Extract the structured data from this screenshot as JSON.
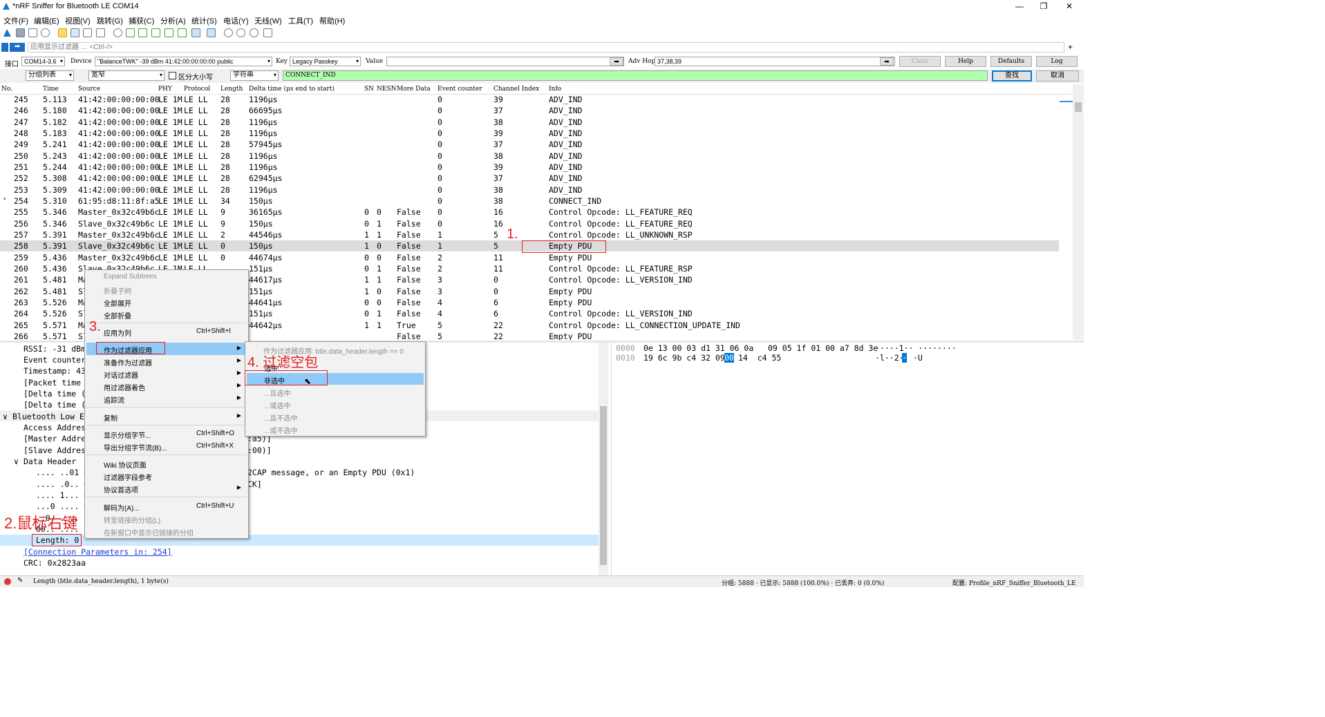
{
  "window": {
    "title": "*nRF Sniffer for Bluetooth LE COM14",
    "minimize": "—",
    "restore": "❐",
    "close": "✕"
  },
  "menu": [
    "文件(F)",
    "编辑(E)",
    "视图(V)",
    "跳转(G)",
    "捕获(C)",
    "分析(A)",
    "统计(S)",
    "电话(Y)",
    "无线(W)",
    "工具(T)",
    "帮助(H)"
  ],
  "filter": {
    "placeholder": "应用显示过滤器 … <Ctrl-/>"
  },
  "options": {
    "interface_label": "接口",
    "interface_value": "COM14-3.6",
    "device_label": "Device",
    "device_value": "\"BalanceTWK\"  -39 dBm  41:42:00:00:00:00  public",
    "key_label": "Key",
    "key_value": "Legacy Passkey",
    "value_label": "Value",
    "adv_hop_label": "Adv Hop",
    "adv_hop_value": "37,38,39",
    "clear": "Clear",
    "help": "Help",
    "defaults": "Defaults",
    "log": "Log"
  },
  "search": {
    "scope": "分组列表",
    "width": "宽窄",
    "case_label": "区分大小写",
    "type": "字符串",
    "text": "CONNECT_IND",
    "find": "查找",
    "cancel": "取消"
  },
  "columns": [
    "No.",
    "Time",
    "Source",
    "PHY",
    "Protocol",
    "Length",
    "Delta time (μs end to start)",
    "SN",
    "NESN",
    "More Data",
    "Event counter",
    "Channel Index",
    "Info"
  ],
  "packets": [
    {
      "no": "245",
      "time": "5.113",
      "src": "41:42:00:00:00:00",
      "phy": "LE 1M",
      "proto": "LE LL",
      "len": "28",
      "delta": "1196μs",
      "sn": "",
      "nesn": "",
      "more": "",
      "ev": "0",
      "ch": "39",
      "info": "ADV_IND"
    },
    {
      "no": "246",
      "time": "5.180",
      "src": "41:42:00:00:00:00",
      "phy": "LE 1M",
      "proto": "LE LL",
      "len": "28",
      "delta": "66695μs",
      "sn": "",
      "nesn": "",
      "more": "",
      "ev": "0",
      "ch": "37",
      "info": "ADV_IND"
    },
    {
      "no": "247",
      "time": "5.182",
      "src": "41:42:00:00:00:00",
      "phy": "LE 1M",
      "proto": "LE LL",
      "len": "28",
      "delta": "1196μs",
      "sn": "",
      "nesn": "",
      "more": "",
      "ev": "0",
      "ch": "38",
      "info": "ADV_IND"
    },
    {
      "no": "248",
      "time": "5.183",
      "src": "41:42:00:00:00:00",
      "phy": "LE 1M",
      "proto": "LE LL",
      "len": "28",
      "delta": "1196μs",
      "sn": "",
      "nesn": "",
      "more": "",
      "ev": "0",
      "ch": "39",
      "info": "ADV_IND"
    },
    {
      "no": "249",
      "time": "5.241",
      "src": "41:42:00:00:00:00",
      "phy": "LE 1M",
      "proto": "LE LL",
      "len": "28",
      "delta": "57945μs",
      "sn": "",
      "nesn": "",
      "more": "",
      "ev": "0",
      "ch": "37",
      "info": "ADV_IND"
    },
    {
      "no": "250",
      "time": "5.243",
      "src": "41:42:00:00:00:00",
      "phy": "LE 1M",
      "proto": "LE LL",
      "len": "28",
      "delta": "1196μs",
      "sn": "",
      "nesn": "",
      "more": "",
      "ev": "0",
      "ch": "38",
      "info": "ADV_IND"
    },
    {
      "no": "251",
      "time": "5.244",
      "src": "41:42:00:00:00:00",
      "phy": "LE 1M",
      "proto": "LE LL",
      "len": "28",
      "delta": "1196μs",
      "sn": "",
      "nesn": "",
      "more": "",
      "ev": "0",
      "ch": "39",
      "info": "ADV_IND"
    },
    {
      "no": "252",
      "time": "5.308",
      "src": "41:42:00:00:00:00",
      "phy": "LE 1M",
      "proto": "LE LL",
      "len": "28",
      "delta": "62945μs",
      "sn": "",
      "nesn": "",
      "more": "",
      "ev": "0",
      "ch": "37",
      "info": "ADV_IND"
    },
    {
      "no": "253",
      "time": "5.309",
      "src": "41:42:00:00:00:00",
      "phy": "LE 1M",
      "proto": "LE LL",
      "len": "28",
      "delta": "1196μs",
      "sn": "",
      "nesn": "",
      "more": "",
      "ev": "0",
      "ch": "38",
      "info": "ADV_IND"
    },
    {
      "no": "254",
      "time": "5.310",
      "src": "61:95:d8:11:8f:a5",
      "phy": "LE 1M",
      "proto": "LE LL",
      "len": "34",
      "delta": "150μs",
      "sn": "",
      "nesn": "",
      "more": "",
      "ev": "0",
      "ch": "38",
      "info": "CONNECT_IND"
    },
    {
      "no": "255",
      "time": "5.346",
      "src": "Master_0x32c49b6c",
      "phy": "LE 1M",
      "proto": "LE LL",
      "len": "9",
      "delta": "36165μs",
      "sn": "0",
      "nesn": "0",
      "more": "False",
      "ev": "0",
      "ch": "16",
      "info": "Control Opcode: LL_FEATURE_REQ"
    },
    {
      "no": "256",
      "time": "5.346",
      "src": "Slave_0x32c49b6c",
      "phy": "LE 1M",
      "proto": "LE LL",
      "len": "9",
      "delta": "150μs",
      "sn": "0",
      "nesn": "1",
      "more": "False",
      "ev": "0",
      "ch": "16",
      "info": "Control Opcode: LL_FEATURE_REQ"
    },
    {
      "no": "257",
      "time": "5.391",
      "src": "Master_0x32c49b6c",
      "phy": "LE 1M",
      "proto": "LE LL",
      "len": "2",
      "delta": "44546μs",
      "sn": "1",
      "nesn": "1",
      "more": "False",
      "ev": "1",
      "ch": "5",
      "info": "Control Opcode: LL_UNKNOWN_RSP"
    },
    {
      "no": "258",
      "time": "5.391",
      "src": "Slave_0x32c49b6c",
      "phy": "LE 1M",
      "proto": "LE LL",
      "len": "0",
      "delta": "150μs",
      "sn": "1",
      "nesn": "0",
      "more": "False",
      "ev": "1",
      "ch": "5",
      "info": "Empty PDU"
    },
    {
      "no": "259",
      "time": "5.436",
      "src": "Master_0x32c49b6c",
      "phy": "LE 1M",
      "proto": "LE LL",
      "len": "0",
      "delta": "44674μs",
      "sn": "0",
      "nesn": "0",
      "more": "False",
      "ev": "2",
      "ch": "11",
      "info": "Empty PDU"
    },
    {
      "no": "260",
      "time": "5.436",
      "src": "Slave_0x32c49b6c",
      "phy": "LE 1M",
      "proto": "LE LL",
      "len": "",
      "delta": "151μs",
      "sn": "0",
      "nesn": "1",
      "more": "False",
      "ev": "2",
      "ch": "11",
      "info": "Control Opcode: LL_FEATURE_RSP"
    },
    {
      "no": "261",
      "time": "5.481",
      "src": "Ma",
      "phy": "",
      "proto": "",
      "len": "",
      "delta": "44617μs",
      "sn": "1",
      "nesn": "1",
      "more": "False",
      "ev": "3",
      "ch": "0",
      "info": "Control Opcode: LL_VERSION_IND"
    },
    {
      "no": "262",
      "time": "5.481",
      "src": "Sl",
      "phy": "",
      "proto": "",
      "len": "",
      "delta": "151μs",
      "sn": "1",
      "nesn": "0",
      "more": "False",
      "ev": "3",
      "ch": "0",
      "info": "Empty PDU"
    },
    {
      "no": "263",
      "time": "5.526",
      "src": "Ma",
      "phy": "",
      "proto": "",
      "len": "",
      "delta": "44641μs",
      "sn": "0",
      "nesn": "0",
      "more": "False",
      "ev": "4",
      "ch": "6",
      "info": "Empty PDU"
    },
    {
      "no": "264",
      "time": "5.526",
      "src": "Sl",
      "phy": "",
      "proto": "",
      "len": "",
      "delta": "151μs",
      "sn": "0",
      "nesn": "1",
      "more": "False",
      "ev": "4",
      "ch": "6",
      "info": "Control Opcode: LL_VERSION_IND"
    },
    {
      "no": "265",
      "time": "5.571",
      "src": "Ma",
      "phy": "",
      "proto": "",
      "len": "",
      "delta": "44642μs",
      "sn": "1",
      "nesn": "1",
      "more": "True",
      "ev": "5",
      "ch": "22",
      "info": "Control Opcode: LL_CONNECTION_UPDATE_IND"
    },
    {
      "no": "266",
      "time": "5.571",
      "src": "Sl",
      "phy": "",
      "proto": "",
      "len": "",
      "delta": "",
      "sn": "",
      "nesn": "",
      "more": "False",
      "ev": "5",
      "ch": "22",
      "info": "Empty PDU"
    }
  ],
  "details": {
    "rssi": "RSSI: -31 dBm",
    "event_counter": "Event counter",
    "timestamp": "Timestamp: 43",
    "packet_time": "[Packet time",
    "delta1": "[Delta time (",
    "delta2": "[Delta time (s",
    "ble_ll": "Bluetooth Low En",
    "access_addr": "Access Address",
    "master_addr": "[Master Addres",
    "master_tail": ":a5)]",
    "slave_addr": "[Slave Addres",
    "slave_tail": ":00)]",
    "data_header": "Data Header",
    "bits1": ".... ..01 =",
    "bits1_tail": "2CAP message, or an Empty PDU (0x1)",
    "bits2": ".... .0.. =",
    "bits2_tail": "CK]",
    "bits3": ".... 1... =",
    "bits4": "...0 .... =",
    "bits5": "..0. ....",
    "bits6": "00.. ....",
    "length": "Length: 0",
    "conn_params": "[Connection Parameters in: 254]",
    "crc": "CRC: 0x2823aa"
  },
  "hex": {
    "off1": "0000",
    "bytes1": "0e 13 00 03 d1 31 06 0a   09 05 1f 01 00 a7 8d 3e",
    "ascii1": "·····1·· ········",
    "off2": "0010",
    "bytes2a": "19 6c 9b c4 32 09",
    "bytes2_sel": "00",
    "bytes2b": "14  c4 55",
    "ascii2a": "·l··2·",
    "ascii2_sel": "·",
    "ascii2b": "·U"
  },
  "context_menu": [
    {
      "label": "Expand Subtrees",
      "shortcut": "",
      "disabled": true
    },
    {
      "label": "折叠子树",
      "shortcut": "",
      "disabled": true
    },
    {
      "label": "全部展开",
      "shortcut": ""
    },
    {
      "label": "全部折叠",
      "shortcut": ""
    },
    {
      "label": "应用为列",
      "shortcut": "Ctrl+Shift+I"
    },
    {
      "label": "作为过滤器应用",
      "shortcut": ""
    },
    {
      "label": "准备作为过滤器",
      "shortcut": ""
    },
    {
      "label": "对话过滤器",
      "shortcut": ""
    },
    {
      "label": "用过滤器着色",
      "shortcut": ""
    },
    {
      "label": "追踪流",
      "shortcut": ""
    },
    {
      "label": "复制",
      "shortcut": ""
    },
    {
      "label": "显示分组字节...",
      "shortcut": "Ctrl+Shift+O"
    },
    {
      "label": "导出分组字节流(B)...",
      "shortcut": "Ctrl+Shift+X"
    },
    {
      "label": "Wiki 协议页面",
      "shortcut": ""
    },
    {
      "label": "过滤器字段参考",
      "shortcut": ""
    },
    {
      "label": "协议首选项",
      "shortcut": ""
    },
    {
      "label": "解码为(A)...",
      "shortcut": "Ctrl+Shift+U"
    },
    {
      "label": "转至链接的分组(L)",
      "shortcut": "",
      "disabled": true
    },
    {
      "label": "在新窗口中显示已链接的分组",
      "shortcut": "",
      "disabled": true
    }
  ],
  "submenu": {
    "header": "作为过滤器应用: btle.data_header.length == 0",
    "items": [
      "选中",
      "非选中",
      "...且选中",
      "...或选中",
      "...且不选中",
      "...或不选中"
    ]
  },
  "annotations": {
    "a1": "1.",
    "a2": "2.鼠标右键",
    "a3": "3.",
    "a4": "4. 过滤空包"
  },
  "status": {
    "field": "Length (btle.data_header.length), 1 byte(s)",
    "packets": "分组: 5888 · 已显示: 5888 (100.0%) · 已丢弃: 0 (0.0%)",
    "profile": "配置: Profile_nRF_Sniffer_Bluetooth_LE"
  },
  "colors": {
    "accent": "#0078d7",
    "annotation": "#e02020",
    "filter_ok": "#afffaf",
    "menu_highlight": "#91c9f7"
  }
}
